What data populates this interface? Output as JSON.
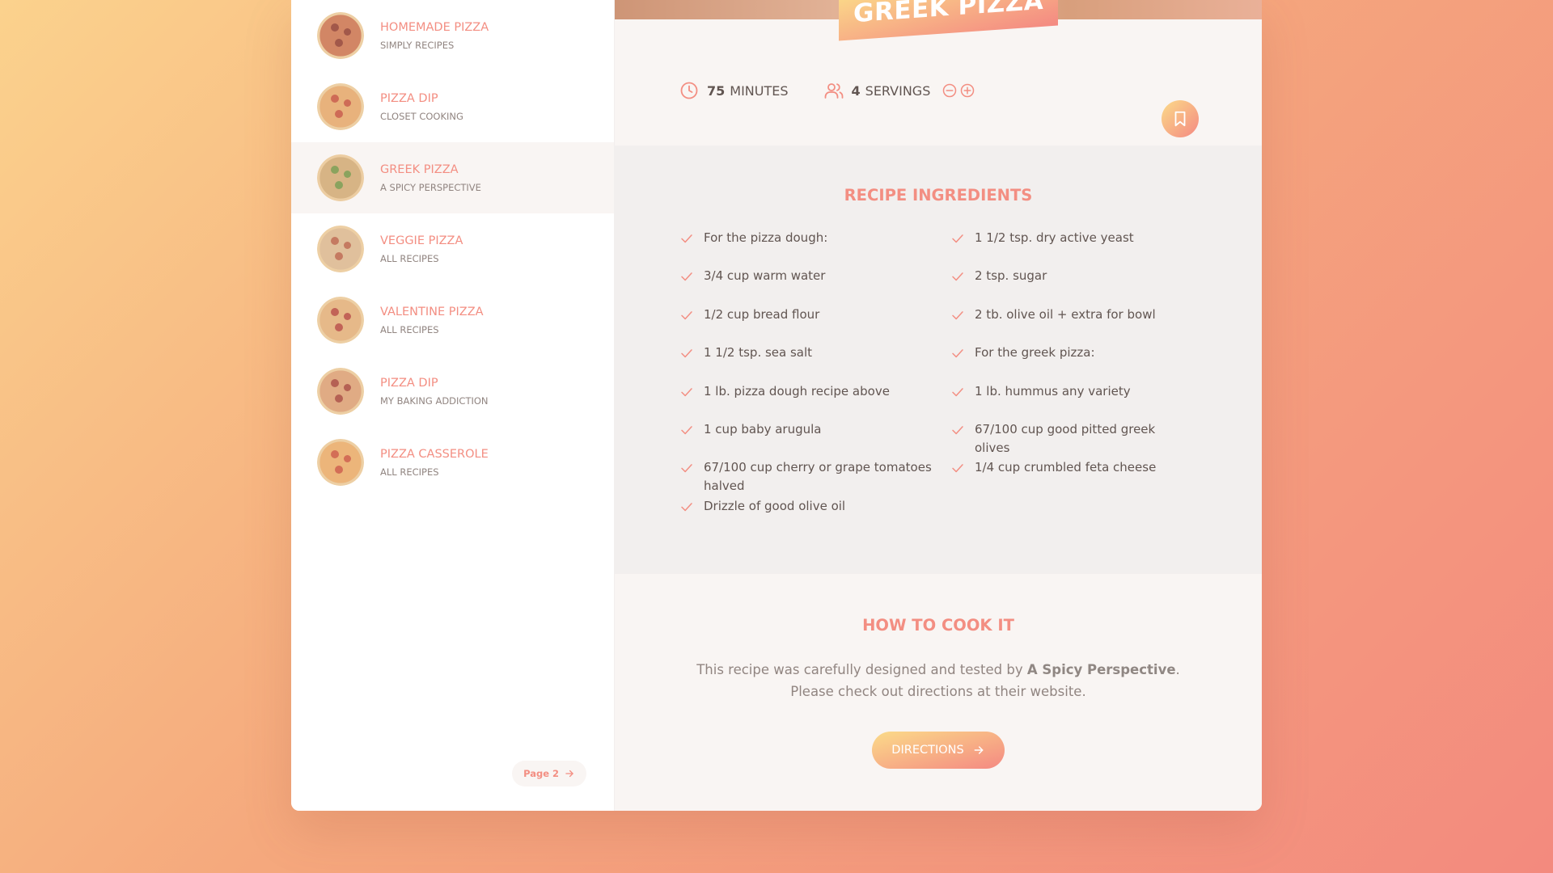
{
  "sidebar": {
    "results": [
      {
        "title": "Homemade Pizza",
        "publisher": "Simply Recipes"
      },
      {
        "title": "Pizza Dip",
        "publisher": "Closet Cooking"
      },
      {
        "title": "Greek Pizza",
        "publisher": "A Spicy Perspective"
      },
      {
        "title": "Veggie Pizza",
        "publisher": "All Recipes"
      },
      {
        "title": "Valentine Pizza",
        "publisher": "All Recipes"
      },
      {
        "title": "Pizza Dip",
        "publisher": "My Baking Addiction"
      },
      {
        "title": "Pizza Casserole",
        "publisher": "All Recipes"
      }
    ],
    "active_index": 2,
    "pager_label": "Page 2"
  },
  "recipe": {
    "title": "Greek Pizza",
    "time_value": "75",
    "time_unit": "minutes",
    "servings_value": "4",
    "servings_unit": "servings",
    "ingredients_heading": "Recipe Ingredients",
    "ingredients_left": [
      "For the pizza dough:",
      "3/4 cup warm water",
      "1/2 cup bread flour",
      "1 1/2 tsp. sea salt",
      "1 lb. pizza dough recipe above",
      "1 cup baby arugula",
      "67/100 cup cherry or grape tomatoes halved",
      "Drizzle of good olive oil"
    ],
    "ingredients_right": [
      "1 1/2 tsp. dry active yeast",
      "2 tsp. sugar",
      "2 tb. olive oil + extra for bowl",
      "For the greek pizza:",
      "1 lb. hummus any variety",
      "67/100 cup good pitted greek olives",
      "1/4 cup crumbled feta cheese"
    ],
    "cook_heading": "How to cook it",
    "cook_text_before": "This recipe was carefully designed and tested by ",
    "cook_publisher": "A Spicy Perspective",
    "cook_text_after": ". Please check out directions at their website.",
    "directions_label": "Directions"
  },
  "colors": {
    "accent": "#f38e82",
    "accent_gradient_start": "#fbdb89",
    "accent_gradient_end": "#f48982",
    "text": "#615551",
    "muted_text": "#918581",
    "panel_light": "#f9f5f3",
    "panel_grey": "#f2efee"
  },
  "icons": {
    "time": "clock-icon",
    "servings": "users-icon",
    "decrease": "minus-circle-icon",
    "increase": "plus-circle-icon",
    "bookmark": "bookmark-icon",
    "ingredient": "check-icon",
    "arrow": "arrow-right-icon"
  }
}
